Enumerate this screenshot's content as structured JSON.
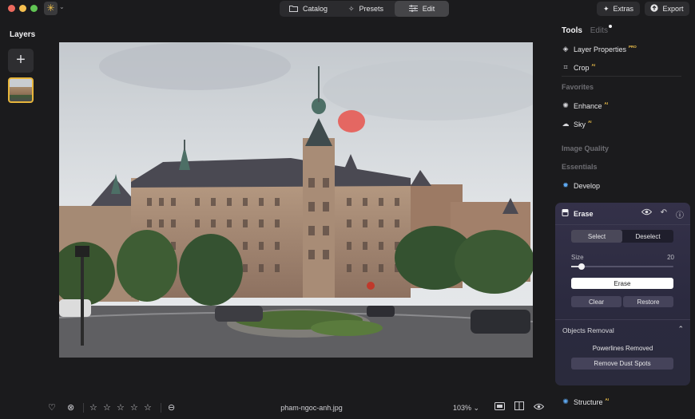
{
  "titlebar": {
    "app_icon": "sun-icon",
    "tabs": [
      {
        "label": "Catalog",
        "icon": "folder-icon"
      },
      {
        "label": "Presets",
        "icon": "sparkle-icon"
      },
      {
        "label": "Edit",
        "icon": "sliders-icon",
        "active": true
      }
    ],
    "extras_label": "Extras",
    "export_label": "Export"
  },
  "layers": {
    "title": "Layers",
    "add_icon": "plus-icon"
  },
  "bottombar": {
    "filename": "pham-ngoc-anh.jpg",
    "zoom": "103%",
    "rating_stars": 5,
    "rating_value": 0
  },
  "right_panel": {
    "tab_tools": "Tools",
    "tab_edits": "Edits",
    "layer_properties": "Layer Properties",
    "layer_properties_badge": "PRO",
    "crop": "Crop",
    "crop_badge": "AI",
    "favorites": "Favorites",
    "enhance": "Enhance",
    "enhance_badge": "AI",
    "sky": "Sky",
    "sky_badge": "AI",
    "image_quality": "Image Quality",
    "essentials": "Essentials",
    "develop": "Develop",
    "structure": "Structure",
    "structure_badge": "AI"
  },
  "erase": {
    "title": "Erase",
    "select_label": "Select",
    "deselect_label": "Deselect",
    "size_label": "Size",
    "size_value": "20",
    "size_slider_fraction": 0.1,
    "erase_button": "Erase",
    "clear_button": "Clear",
    "restore_button": "Restore",
    "objects_removal": "Objects Removal",
    "powerlines_removed": "Powerlines Removed",
    "remove_dust": "Remove Dust Spots"
  },
  "colors": {
    "accent_yellow": "#e7b53b",
    "erase_panel": "#343149",
    "mask_red": "#e8544c"
  }
}
